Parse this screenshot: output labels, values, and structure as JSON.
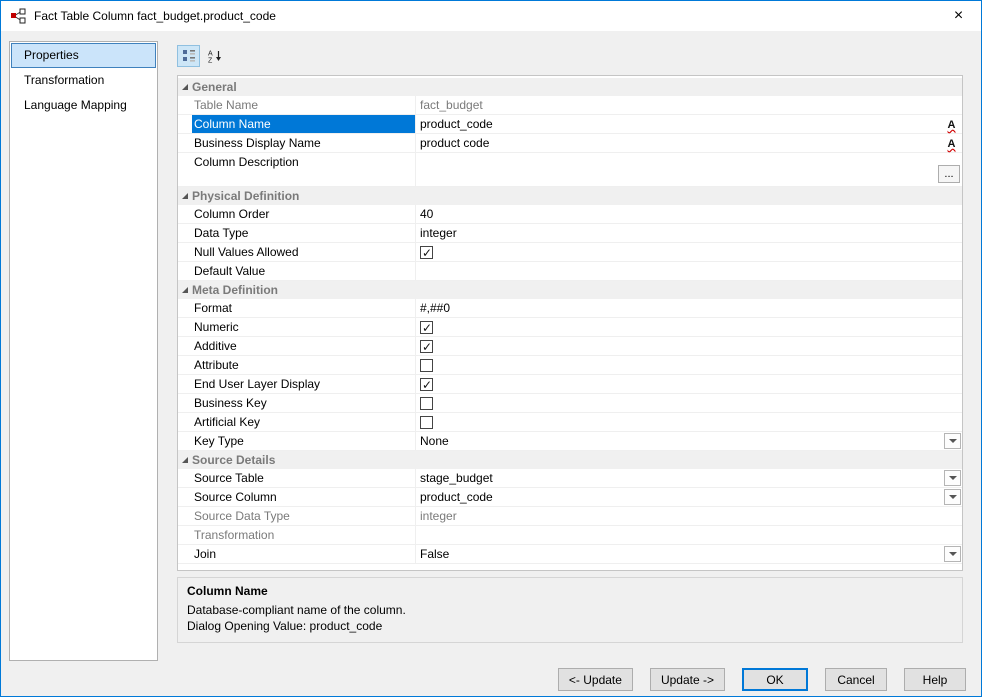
{
  "window": {
    "title": "Fact Table Column fact_budget.product_code"
  },
  "colors": {
    "accent": "#0078d7",
    "selected_row": "#0078d7",
    "disabled_text": "#7a7a7a"
  },
  "icons": {
    "close": "×",
    "check": "✓",
    "font_icon_letter": "A",
    "ellipsis": "..."
  },
  "sidebar": {
    "items": [
      {
        "label": "Properties",
        "selected": true
      },
      {
        "label": "Transformation",
        "selected": false
      },
      {
        "label": "Language Mapping",
        "selected": false
      }
    ]
  },
  "toolbar": {
    "icons": [
      {
        "name": "categorized-icon",
        "toggled": true
      },
      {
        "name": "sort-alphabetical-icon",
        "toggled": false
      }
    ]
  },
  "grid": {
    "sections": [
      {
        "title": "General",
        "rows": [
          {
            "label": "Table Name",
            "value": "fact_budget",
            "disabled": true
          },
          {
            "label": "Column Name",
            "value": "product_code",
            "selected": true
          },
          {
            "label": "Business Display Name",
            "value": "product code"
          },
          {
            "label": "Column Description",
            "value": ""
          }
        ]
      },
      {
        "title": "Physical Definition",
        "rows": [
          {
            "label": "Column Order",
            "value": "40"
          },
          {
            "label": "Data Type",
            "value": "integer"
          },
          {
            "label": "Null Values Allowed",
            "checked": true
          },
          {
            "label": "Default Value",
            "value": ""
          }
        ]
      },
      {
        "title": "Meta Definition",
        "rows": [
          {
            "label": "Format",
            "value": "#,##0"
          },
          {
            "label": "Numeric",
            "checked": true
          },
          {
            "label": "Additive",
            "checked": true
          },
          {
            "label": "Attribute",
            "checked": false
          },
          {
            "label": "End User Layer Display",
            "checked": true
          },
          {
            "label": "Business Key",
            "checked": false
          },
          {
            "label": "Artificial Key",
            "checked": false
          },
          {
            "label": "Key Type",
            "value": "None",
            "control": "dropdown"
          }
        ]
      },
      {
        "title": "Source Details",
        "rows": [
          {
            "label": "Source Table",
            "value": "stage_budget",
            "control": "dropdown"
          },
          {
            "label": "Source Column",
            "value": "product_code",
            "control": "dropdown"
          },
          {
            "label": "Source Data Type",
            "value": "integer",
            "disabled": true
          },
          {
            "label": "Transformation",
            "value": "",
            "disabled": true
          },
          {
            "label": "Join",
            "value": "False",
            "control": "dropdown"
          }
        ]
      }
    ]
  },
  "description": {
    "title": "Column Name",
    "line1": "Database-compliant name of the column.",
    "line2": "Dialog Opening Value: product_code"
  },
  "footer": {
    "buttons": [
      "<- Update",
      "Update ->",
      "OK",
      "Cancel",
      "Help"
    ]
  }
}
